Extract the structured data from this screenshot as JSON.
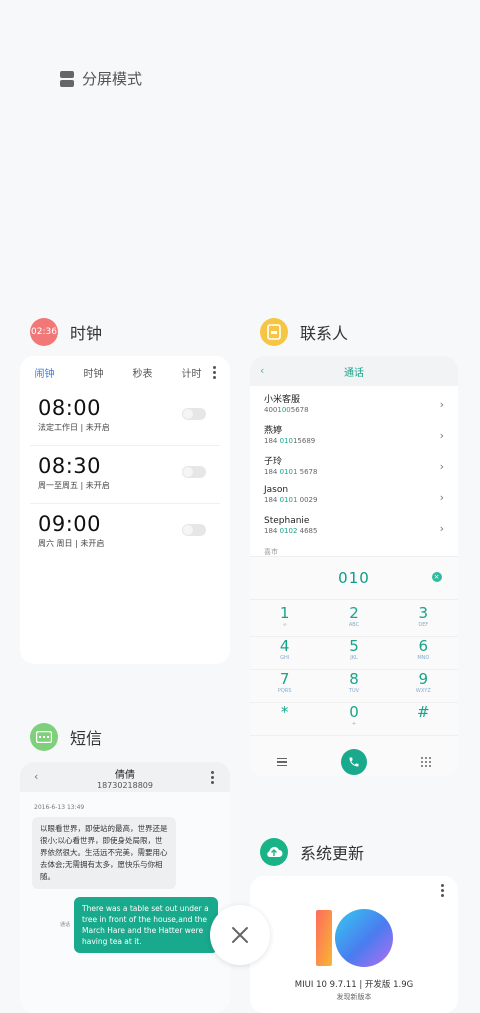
{
  "split_screen": {
    "label": "分屏模式"
  },
  "clock": {
    "app_name": "时钟",
    "icon_text": "02:36",
    "tabs": [
      "闹钟",
      "时钟",
      "秒表",
      "计时"
    ],
    "alarms": [
      {
        "time": "08:00",
        "desc": "法定工作日 | 未开启"
      },
      {
        "time": "08:30",
        "desc": "周一至周五 | 未开启"
      },
      {
        "time": "09:00",
        "desc": "周六 周日 | 未开启"
      }
    ]
  },
  "contacts": {
    "app_name": "联系人",
    "tab_title": "通话",
    "items": [
      {
        "name": "小米客服",
        "phone_pre": "400",
        "phone_hl": "100",
        "phone_post": "5678"
      },
      {
        "name": "燕婷",
        "phone_pre": "184 ",
        "phone_hl": "010",
        "phone_post": "15689"
      },
      {
        "name": "子玲",
        "phone_pre": "184 ",
        "phone_hl": "0101",
        "phone_post": " 5678"
      },
      {
        "name": "Jason",
        "phone_pre": "184 ",
        "phone_hl": "0101",
        "phone_post": " 0029"
      },
      {
        "name": "Stephanie",
        "phone_pre": "184 ",
        "phone_hl": "0102",
        "phone_post": " 4685"
      }
    ],
    "faded_item": "喜市",
    "dial_value": "010",
    "keys": [
      {
        "d": "1",
        "l": "∞"
      },
      {
        "d": "2",
        "l": "ABC"
      },
      {
        "d": "3",
        "l": "DEF"
      },
      {
        "d": "4",
        "l": "GHI"
      },
      {
        "d": "5",
        "l": "JKL"
      },
      {
        "d": "6",
        "l": "MNO"
      },
      {
        "d": "7",
        "l": "PQRS"
      },
      {
        "d": "8",
        "l": "TUV"
      },
      {
        "d": "9",
        "l": "WXYZ"
      },
      {
        "d": "*",
        "l": ""
      },
      {
        "d": "0",
        "l": "+"
      },
      {
        "d": "#",
        "l": ""
      }
    ]
  },
  "messages": {
    "app_name": "短信",
    "contact_name": "倩倩",
    "contact_phone": "18730218809",
    "date": "2016-6-13 13:49",
    "incoming": "以眼看世界，即使站的最高，世界还是很小;以心看世界，即使身处局限，世界依然很大。生活远不完美，需要用心去体会;无需拥有太多，愿快乐与你相随。",
    "outgoing_label": "通话",
    "outgoing": "There was a table set out under a tree in front of the house,and the March Hare and the Hatter were having tea at it."
  },
  "update": {
    "app_name": "系统更新",
    "version": "MIUI 10 9.7.11 | 开发版 1.9G",
    "sub": "发现新版本"
  },
  "colors": {
    "accent": "#19a389",
    "clock_icon": "#f27878",
    "contacts_icon": "#f6c544",
    "sms_icon": "#7ed07a",
    "update_icon": "#19b388"
  }
}
